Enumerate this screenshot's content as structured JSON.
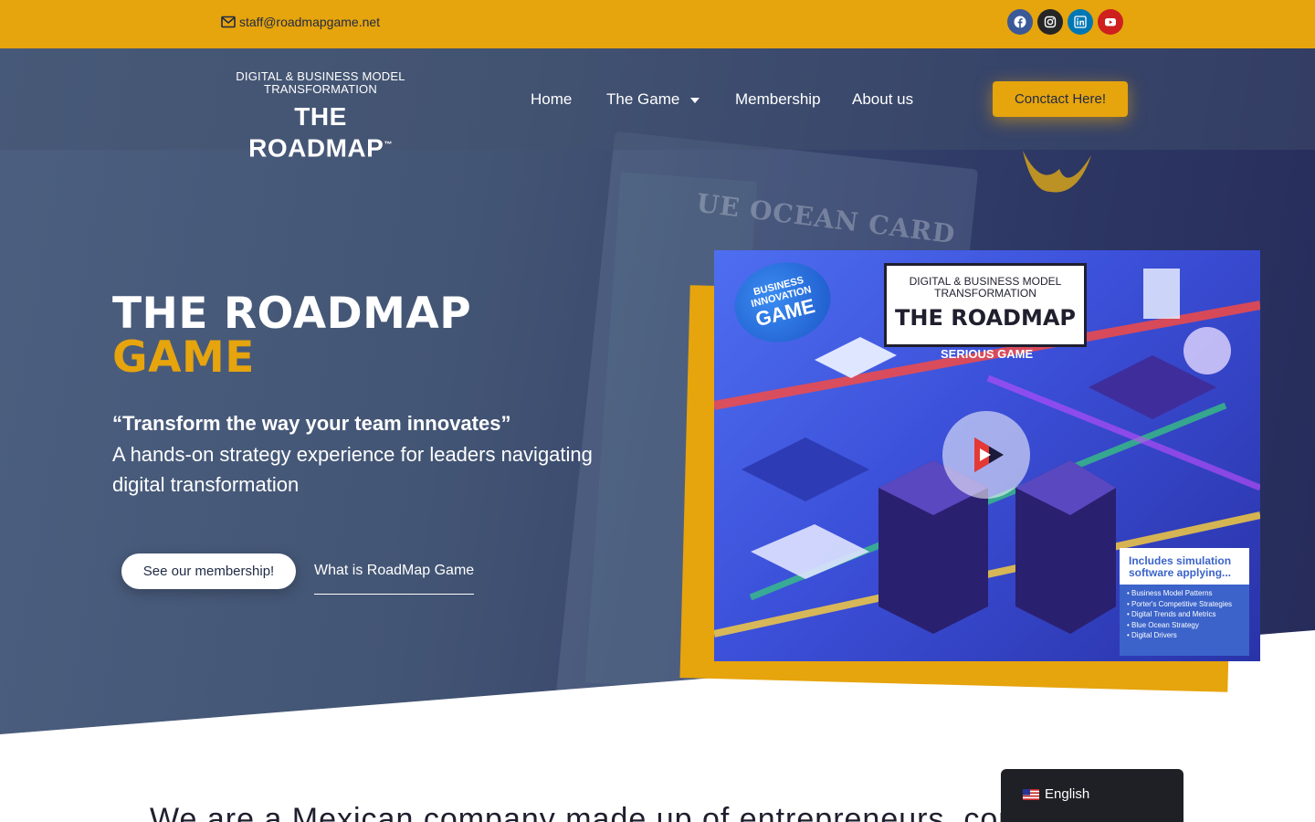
{
  "topbar": {
    "email": "staff@roadmapgame.net",
    "email_icon": "envelope-icon",
    "socials": [
      {
        "name": "facebook",
        "icon": "facebook-icon",
        "color": "#3b5998"
      },
      {
        "name": "instagram",
        "icon": "instagram-icon",
        "color": "#262626"
      },
      {
        "name": "linkedin",
        "icon": "linkedin-icon",
        "color": "#0077b5"
      },
      {
        "name": "youtube",
        "icon": "youtube-icon",
        "color": "#cd201f"
      }
    ],
    "background": "#e6a40d"
  },
  "header": {
    "logo_subtitle": "DIGITAL & BUSINESS MODEL TRANSFORMATION",
    "logo_title": "THE ROADMAP",
    "logo_mark": "™",
    "nav": [
      {
        "label": "Home"
      },
      {
        "label": "The Game",
        "has_dropdown": true
      },
      {
        "label": "Membership"
      },
      {
        "label": "About us"
      }
    ],
    "cta_label": "Conctact Here!"
  },
  "hero": {
    "title_line1": "THE ROADMAP",
    "title_line2": "GAME",
    "quote": "“Transform the way your team innovates”",
    "description": "A hands-on strategy experience for leaders navigating digital transformation",
    "primary_button": "See our membership!",
    "secondary_link": "What is RoadMap Game",
    "background_card_text": "UE OCEAN CARD",
    "accent_color": "#e6a40d"
  },
  "product_box": {
    "badge_line1": "BUSINESS",
    "badge_line2": "INNOVATION",
    "badge_line3": "GAME",
    "card_subtitle": "DIGITAL & BUSINESS MODEL TRANSFORMATION",
    "card_title": "THE ROADMAP",
    "tagline": "SERIOUS GAME",
    "info_heading": "Includes simulation software applying...",
    "info_items": [
      "• Business Model Patterns",
      "• Porter's Competitive Strategies",
      "• Digital Trends and Metrics",
      "• Blue Ocean Strategy",
      "• Digital Drivers"
    ],
    "play_icon": "play-icon"
  },
  "section": {
    "intro_text": "We are a Mexican company made up of entrepreneurs, con"
  },
  "language_switcher": {
    "label": "English",
    "flag_icon": "us-flag-icon"
  }
}
